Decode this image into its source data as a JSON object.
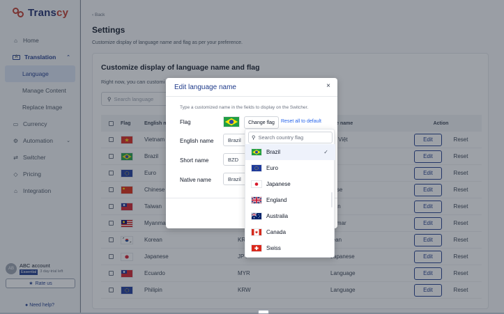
{
  "brand": {
    "name_a": "Trans",
    "name_b": "cy"
  },
  "sidebar": {
    "items": [
      {
        "label": "Home",
        "icon": "home-icon"
      },
      {
        "label": "Translation",
        "icon": "translate-icon"
      },
      {
        "label": "Language"
      },
      {
        "label": "Manage Content"
      },
      {
        "label": "Replace Image"
      },
      {
        "label": "Currency",
        "icon": "currency-icon"
      },
      {
        "label": "Automation",
        "icon": "automation-icon"
      },
      {
        "label": "Switcher",
        "icon": "switcher-icon"
      },
      {
        "label": "Pricing",
        "icon": "pricing-icon"
      },
      {
        "label": "Integration",
        "icon": "integration-icon"
      }
    ],
    "account": {
      "avatar": "AB",
      "name": "ABC account",
      "plan": "Essential",
      "trial": "3 day-trial left",
      "rate": "Rate us"
    },
    "help": "Need help?"
  },
  "main": {
    "back": "Back",
    "title": "Settings",
    "subtitle": "Customize display of language name and flag as per your preference.",
    "card_title": "Customize display of language name and flag",
    "card_desc": "Right now, you can customi",
    "search_placeholder": "Search language"
  },
  "table": {
    "headers": {
      "flag": "Flag",
      "english": "English na",
      "native": "tive name",
      "action": "Action"
    },
    "edit_label": "Edit",
    "reset_label": "Reset",
    "rows": [
      {
        "flag": "vietnam",
        "english": "Vietnam",
        "short": "",
        "native": "ng Việt"
      },
      {
        "flag": "brazil",
        "english": "Brazil",
        "short": "",
        "native": "zil"
      },
      {
        "flag": "eu",
        "english": "Euro",
        "short": "",
        "native": "o"
      },
      {
        "flag": "china",
        "english": "Chinese",
        "short": "",
        "native": "nese"
      },
      {
        "flag": "taiwan",
        "english": "Taiwan",
        "short": "",
        "native": "wan"
      },
      {
        "flag": "malaysia",
        "english": "Myanmar",
        "short": "MY",
        "native": "anmar"
      },
      {
        "flag": "korea",
        "english": "Korean",
        "short": "KRV",
        "native": "rean"
      },
      {
        "flag": "japan",
        "english": "Japanese",
        "short": "JPY",
        "native": "Japanese"
      },
      {
        "flag": "taiwan",
        "english": "Ecuardo",
        "short": "MYR",
        "native": "Language"
      },
      {
        "flag": "eu",
        "english": "Philipin",
        "short": "KRW",
        "native": "Language"
      }
    ]
  },
  "modal": {
    "title": "Edit language name",
    "close": "×",
    "hint": "Type a customized name in the fields to display on the Switcher.",
    "flag_label": "Flag",
    "change_flag": "Change flag",
    "reset_all": "Reset all to default",
    "english_label": "English name",
    "english_value": "Brazil",
    "short_label": "Short name",
    "short_value": "BZD",
    "native_label": "Native name",
    "native_value": "Brazil"
  },
  "dropdown": {
    "placeholder": "Search country flag",
    "check": "✓",
    "items": [
      {
        "label": "Brazil",
        "flag": "brazil",
        "selected": true
      },
      {
        "label": "Euro",
        "flag": "eu"
      },
      {
        "label": "Japanese",
        "flag": "japan"
      },
      {
        "label": "England",
        "flag": "uk"
      },
      {
        "label": "Australia",
        "flag": "australia"
      },
      {
        "label": "Canada",
        "flag": "canada"
      },
      {
        "label": "Swiss",
        "flag": "swiss"
      }
    ]
  },
  "colors": {
    "brand_red": "#c0392b",
    "brand_navy": "#1e3a8a",
    "link_blue": "#2563eb"
  }
}
